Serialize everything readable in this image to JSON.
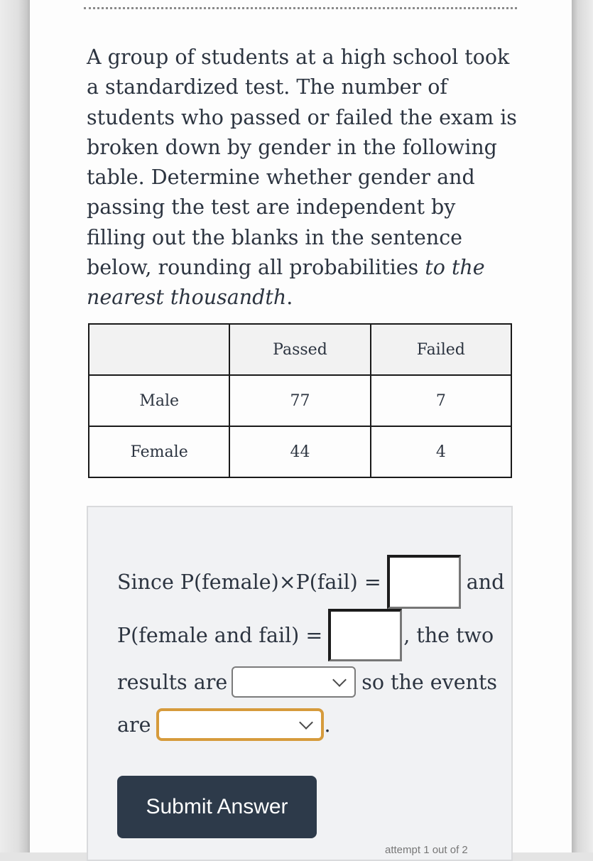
{
  "question": {
    "text_main": "A group of students at a high school took a standardized test. The number of students who passed or failed the exam is broken down by gender in the following table. Determine whether gender and passing the test are independent by filling out the blanks in the sentence below, rounding all probabilities ",
    "text_italic": "to the nearest thousandth",
    "text_end": "."
  },
  "table": {
    "headers": [
      "",
      "Passed",
      "Failed"
    ],
    "rows": [
      {
        "label": "Male",
        "passed": "77",
        "failed": "7"
      },
      {
        "label": "Female",
        "passed": "44",
        "failed": "4"
      }
    ]
  },
  "answer": {
    "line1_prefix": "Since P(female)×P(fail) =",
    "line1_suffix": "and",
    "line2_prefix": "P(female and fail) =",
    "line2_suffix": ", the two",
    "line3_prefix": "results are",
    "line3_suffix": "so the events",
    "line4_prefix": "are",
    "line4_suffix": ".",
    "input1_value": "",
    "input2_value": "",
    "select1_value": "",
    "select2_value": ""
  },
  "submit_label": "Submit Answer",
  "attempt_text": "attempt 1 out of 2"
}
